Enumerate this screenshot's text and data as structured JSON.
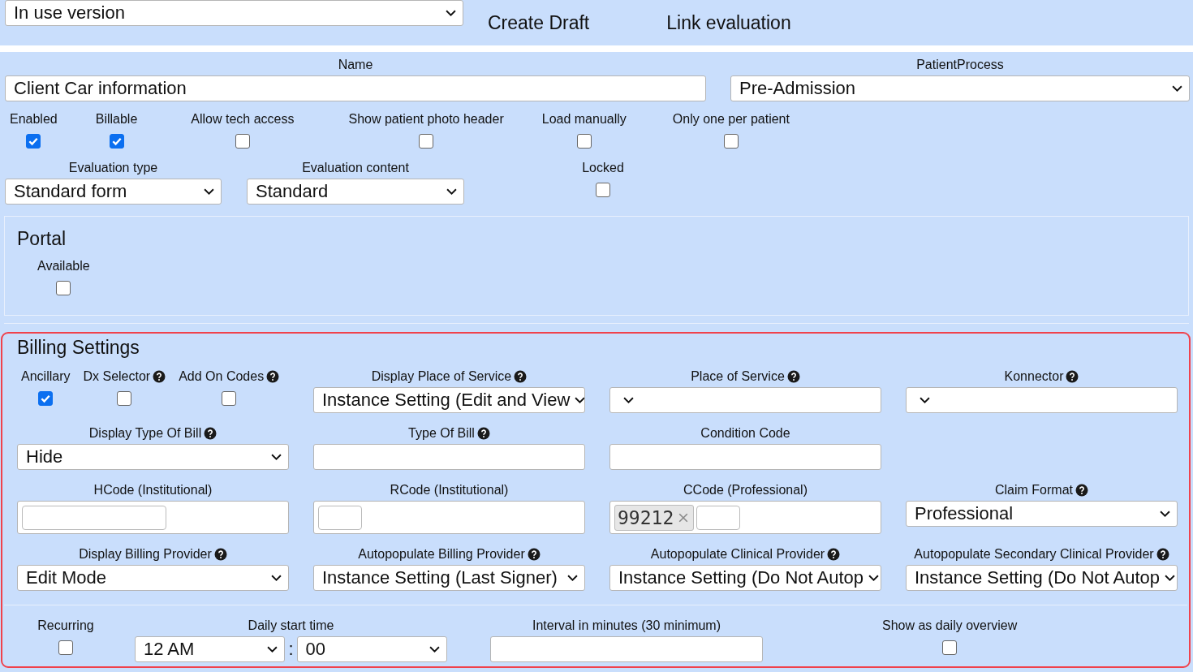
{
  "toolbar": {
    "version_select": "In use version",
    "links": [
      "Create Draft",
      "Link evaluation"
    ]
  },
  "name_field": {
    "label": "Name",
    "value": "Client Car information"
  },
  "patient_process": {
    "label": "PatientProcess",
    "value": "Pre-Admission"
  },
  "options": [
    {
      "label": "Enabled",
      "checked": true
    },
    {
      "label": "Billable",
      "checked": true
    },
    {
      "label": "Allow tech access",
      "checked": false
    },
    {
      "label": "Show patient photo header",
      "checked": false
    },
    {
      "label": "Load manually",
      "checked": false
    },
    {
      "label": "Only one per patient",
      "checked": false
    }
  ],
  "evaluation_type": {
    "label": "Evaluation type",
    "value": "Standard form"
  },
  "evaluation_content": {
    "label": "Evaluation content",
    "value": "Standard"
  },
  "locked": {
    "label": "Locked",
    "checked": false
  },
  "portal": {
    "title": "Portal",
    "available": {
      "label": "Available",
      "checked": false
    }
  },
  "billing": {
    "title": "Billing Settings",
    "rows": [
      [
        {
          "kind": "checkgroup",
          "items": [
            {
              "label": "Ancillary",
              "help": false,
              "checked": true
            },
            {
              "label": "Dx Selector",
              "help": true,
              "checked": false
            },
            {
              "label": "Add On Codes",
              "help": true,
              "checked": false
            }
          ]
        },
        {
          "kind": "select",
          "label": "Display Place of Service",
          "help": true,
          "value": "Instance Setting (Edit and View"
        },
        {
          "kind": "select",
          "label": "Place of Service",
          "help": true
        },
        {
          "kind": "select",
          "label": "Konnector",
          "help": true
        }
      ],
      [
        {
          "kind": "select",
          "label": "Display Type Of Bill",
          "help": true,
          "value": "Hide"
        },
        {
          "kind": "text",
          "label": "Type Of Bill",
          "help": true
        },
        {
          "kind": "text",
          "label": "Condition Code",
          "help": false
        }
      ],
      [
        {
          "kind": "tags",
          "label": "HCode (Institutional)",
          "help": false
        },
        {
          "kind": "tags",
          "label": "RCode (Institutional)",
          "help": false
        },
        {
          "kind": "tags",
          "label": "CCode (Professional)",
          "help": false,
          "tags": [
            "99212"
          ]
        },
        {
          "kind": "select",
          "label": "Claim Format",
          "help": true,
          "value": "Professional"
        }
      ],
      [
        {
          "kind": "select",
          "label": "Display Billing Provider",
          "help": true,
          "value": "Edit Mode"
        },
        {
          "kind": "select",
          "label": "Autopopulate Billing Provider",
          "help": true,
          "value": "Instance Setting (Last Signer)"
        },
        {
          "kind": "select",
          "label": "Autopopulate Clinical Provider",
          "help": true,
          "value": "Instance Setting (Do Not Autop"
        },
        {
          "kind": "select",
          "label": "Autopopulate Secondary Clinical Provider",
          "help": true,
          "value": "Instance Setting (Do Not Autop"
        }
      ]
    ]
  },
  "schedule": {
    "recurring": {
      "label": "Recurring",
      "checked": false
    },
    "start_time": {
      "label": "Daily start time",
      "hour": "12 AM",
      "separator": ":",
      "minute": "00"
    },
    "interval": {
      "label": "Interval in minutes (30 minimum)"
    },
    "daily_overview": {
      "label": "Show as daily overview",
      "checked": false
    }
  }
}
